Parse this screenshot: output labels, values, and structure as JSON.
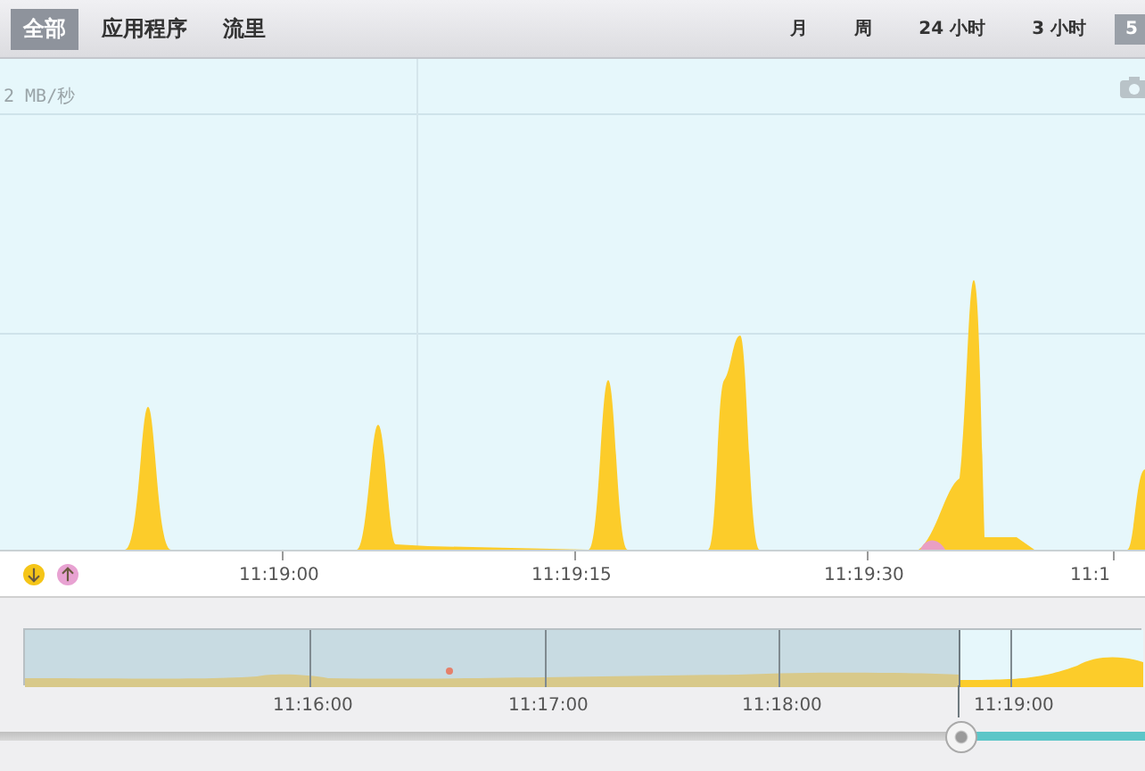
{
  "tabs": [
    {
      "label": "全部",
      "selected": true
    },
    {
      "label": "应用程序",
      "selected": false
    },
    {
      "label": "流里",
      "selected": false
    }
  ],
  "ranges": [
    {
      "label": "月",
      "selected": false
    },
    {
      "label": "周",
      "selected": false
    },
    {
      "label": "24 小时",
      "selected": false
    },
    {
      "label": "3 小时",
      "selected": false
    },
    {
      "label": "5",
      "selected": true
    }
  ],
  "chart": {
    "y_label": "2 MB/秒",
    "x_labels": [
      "11:19:00",
      "11:19:15",
      "11:19:30",
      "11:1"
    ]
  },
  "legend": [
    {
      "kind": "download",
      "color": "#f5c518"
    },
    {
      "kind": "upload",
      "color": "#e8a2d2"
    }
  ],
  "overview": {
    "x_labels": [
      "11:16:00",
      "11:17:00",
      "11:18:00",
      "11:19:00"
    ]
  },
  "slider": {
    "level": 0.84
  }
}
